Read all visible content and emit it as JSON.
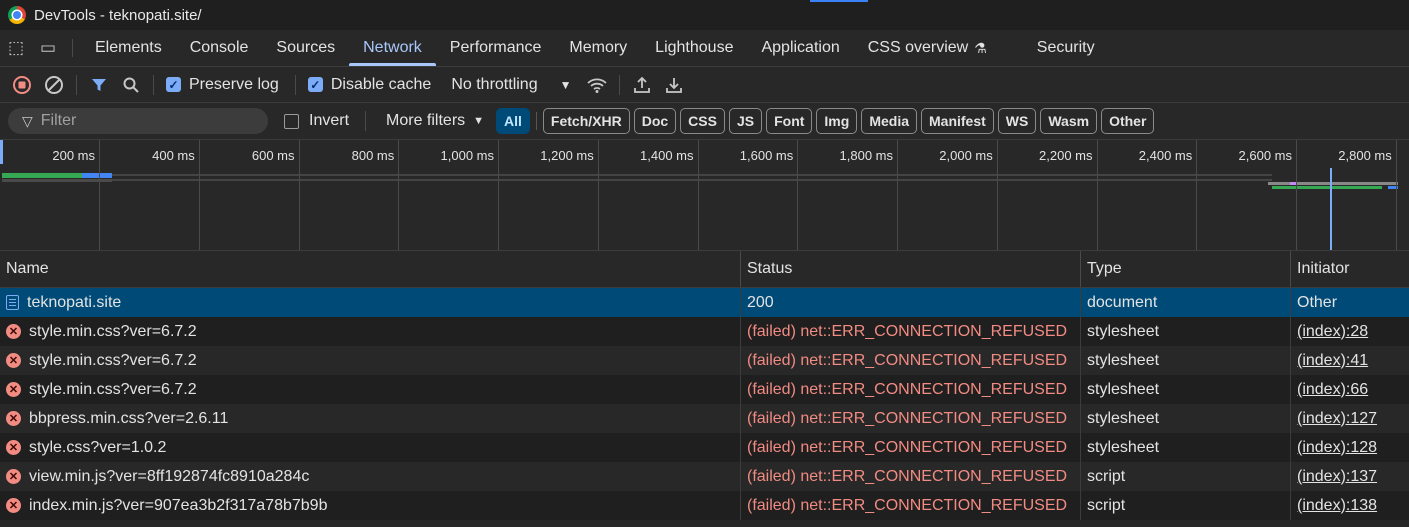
{
  "window": {
    "title": "DevTools - teknopati.site/"
  },
  "tabs": [
    {
      "label": "Elements"
    },
    {
      "label": "Console"
    },
    {
      "label": "Sources"
    },
    {
      "label": "Network"
    },
    {
      "label": "Performance"
    },
    {
      "label": "Memory"
    },
    {
      "label": "Lighthouse"
    },
    {
      "label": "Application"
    },
    {
      "label": "CSS overview"
    },
    {
      "label": "Security"
    }
  ],
  "toolbar": {
    "preserve_log": "Preserve log",
    "disable_cache": "Disable cache",
    "throttling": "No throttling"
  },
  "filterbar": {
    "placeholder": "Filter",
    "invert": "Invert",
    "more_filters": "More filters",
    "chips": [
      "All",
      "Fetch/XHR",
      "Doc",
      "CSS",
      "JS",
      "Font",
      "Img",
      "Media",
      "Manifest",
      "WS",
      "Wasm",
      "Other"
    ]
  },
  "timeline": {
    "ticks": [
      "200 ms",
      "400 ms",
      "600 ms",
      "800 ms",
      "1,000 ms",
      "1,200 ms",
      "1,400 ms",
      "1,600 ms",
      "1,800 ms",
      "2,000 ms",
      "2,200 ms",
      "2,400 ms",
      "2,600 ms",
      "2,800 ms"
    ]
  },
  "grid": {
    "headers": {
      "name": "Name",
      "status": "Status",
      "type": "Type",
      "initiator": "Initiator"
    },
    "rows": [
      {
        "name": "teknopati.site",
        "status": "200",
        "type": "document",
        "initiator": "Other"
      },
      {
        "name": "style.min.css?ver=6.7.2",
        "status": "(failed) net::ERR_CONNECTION_REFUSED",
        "type": "stylesheet",
        "initiator": "(index):28"
      },
      {
        "name": "style.min.css?ver=6.7.2",
        "status": "(failed) net::ERR_CONNECTION_REFUSED",
        "type": "stylesheet",
        "initiator": "(index):41"
      },
      {
        "name": "style.min.css?ver=6.7.2",
        "status": "(failed) net::ERR_CONNECTION_REFUSED",
        "type": "stylesheet",
        "initiator": "(index):66"
      },
      {
        "name": "bbpress.min.css?ver=2.6.11",
        "status": "(failed) net::ERR_CONNECTION_REFUSED",
        "type": "stylesheet",
        "initiator": "(index):127"
      },
      {
        "name": "style.css?ver=1.0.2",
        "status": "(failed) net::ERR_CONNECTION_REFUSED",
        "type": "stylesheet",
        "initiator": "(index):128"
      },
      {
        "name": "view.min.js?ver=8ff192874fc8910a284c",
        "status": "(failed) net::ERR_CONNECTION_REFUSED",
        "type": "script",
        "initiator": "(index):137"
      },
      {
        "name": "index.min.js?ver=907ea3b2f317a78b7b9b",
        "status": "(failed) net::ERR_CONNECTION_REFUSED",
        "type": "script",
        "initiator": "(index):138"
      }
    ]
  },
  "colors": {
    "accent": "#a8c7fa",
    "error": "#f28b82",
    "selected_row": "#004a77"
  }
}
